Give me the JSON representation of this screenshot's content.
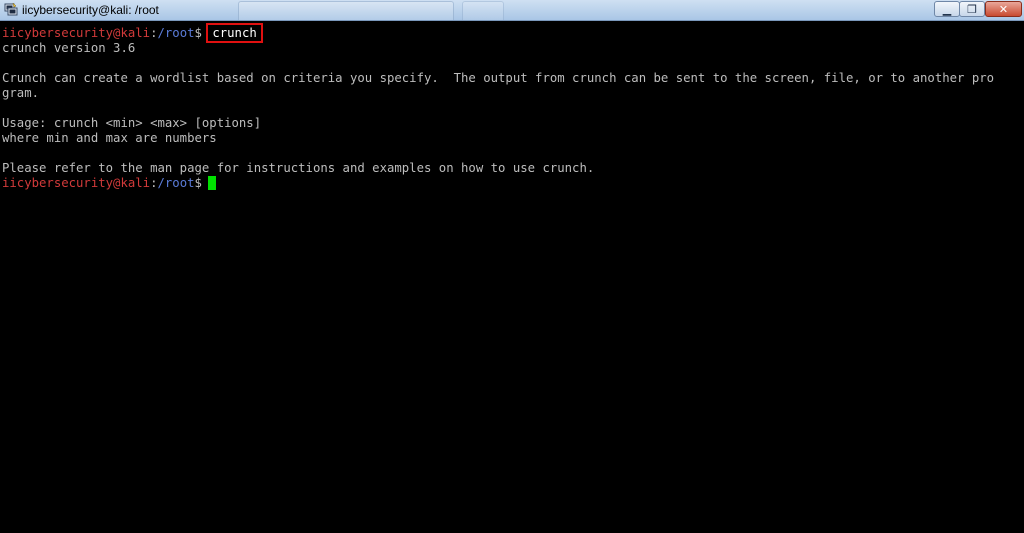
{
  "window": {
    "title": "iicybersecurity@kali: /root",
    "app_icon": "putty-terminal-icon",
    "minimize_glyph": "▁",
    "maximize_glyph": "❐",
    "close_glyph": "✕"
  },
  "colors": {
    "background": "#000000",
    "text": "#bdbdbd",
    "user": "#d23a3a",
    "path": "#5a7bd8",
    "highlight_box": "#e01010",
    "cursor": "#00e000"
  },
  "prompt": {
    "user_host": "iicybersecurity@kali",
    "separator": ":",
    "path": "/root",
    "symbol": "$"
  },
  "terminal": {
    "command": "crunch",
    "version_line": "crunch version 3.6",
    "desc_line1": "Crunch can create a wordlist based on criteria you specify.  The output from crunch can be sent to the screen, file, or to another pro",
    "desc_line2": "gram.",
    "usage_line": "Usage: crunch <min> <max> [options]",
    "where_line": "where min and max are numbers",
    "refer_line": "Please refer to the man page for instructions and examples on how to use crunch."
  }
}
